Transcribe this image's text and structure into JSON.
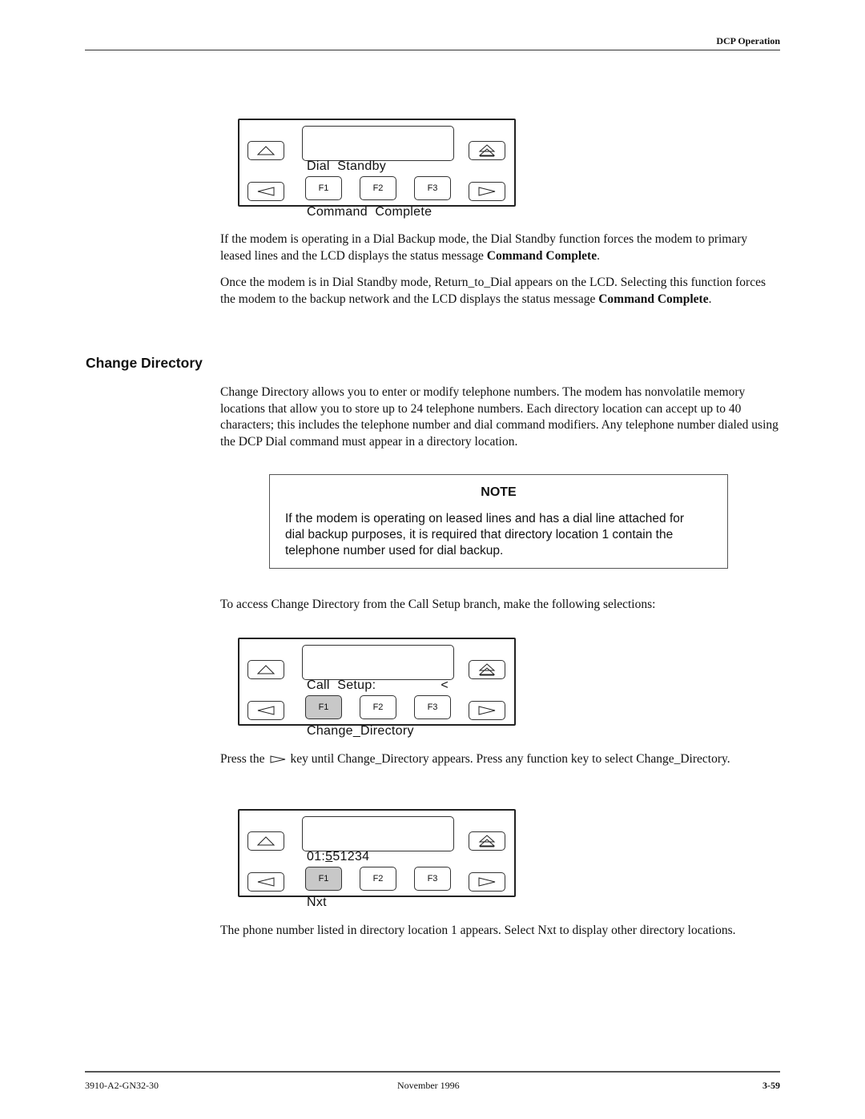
{
  "header": {
    "section_title": "DCP Operation"
  },
  "panels": [
    {
      "lcd_line1": "Dial  Standby",
      "lcd_line1_right": "",
      "lcd_line2": "Command  Complete",
      "keys": {
        "f1": "F1",
        "f2": "F2",
        "f3": "F3"
      },
      "pressed": ""
    },
    {
      "lcd_line1": "Call  Setup:",
      "lcd_line1_right": "<",
      "lcd_line2": "Change_Directory",
      "keys": {
        "f1": "F1",
        "f2": "F2",
        "f3": "F3"
      },
      "pressed": "F1"
    },
    {
      "lcd_line1_prefix": "01:",
      "lcd_line1_cursor": "5",
      "lcd_line1_rest": "51234",
      "lcd_line2": "Nxt",
      "keys": {
        "f1": "F1",
        "f2": "F2",
        "f3": "F3"
      },
      "pressed": "F1"
    }
  ],
  "text": {
    "p1_a": "If the modem is operating in a Dial Backup mode, the Dial Standby function forces the modem to primary leased lines and the LCD displays the status message ",
    "p1_bold": "Command Complete",
    "p1_end": ".",
    "p2_a": "Once the modem is in Dial Standby mode, Return_to_Dial appears on the LCD. Selecting this function forces the modem to the backup network and the LCD displays the status message ",
    "p2_bold": "Command Complete",
    "p2_end": ".",
    "section_heading": "Change Directory",
    "p3": "Change Directory allows you to enter or modify telephone numbers. The modem has nonvolatile memory locations that allow you to store up to 24 telephone numbers. Each directory location can accept up to 40 characters; this includes the telephone number and dial command modifiers. Any telephone number dialed using the DCP Dial command must appear in a directory location.",
    "note_title": "NOTE",
    "note_body": "If the modem is operating on leased lines and has a dial line attached for dial backup purposes, it is required that directory location 1 contain the telephone number used for dial backup.",
    "p4": "To access Change Directory from the Call Setup branch, make the following selections:",
    "p5_a": "Press the",
    "p5_b": "key until Change_Directory appears. Press any function key to select Change_Directory.",
    "p6": "The phone number listed in directory location 1 appears. Select Nxt to display other directory locations."
  },
  "footer": {
    "doc_number": "3910-A2-GN32-30",
    "date": "November 1996",
    "page": "3-59"
  }
}
